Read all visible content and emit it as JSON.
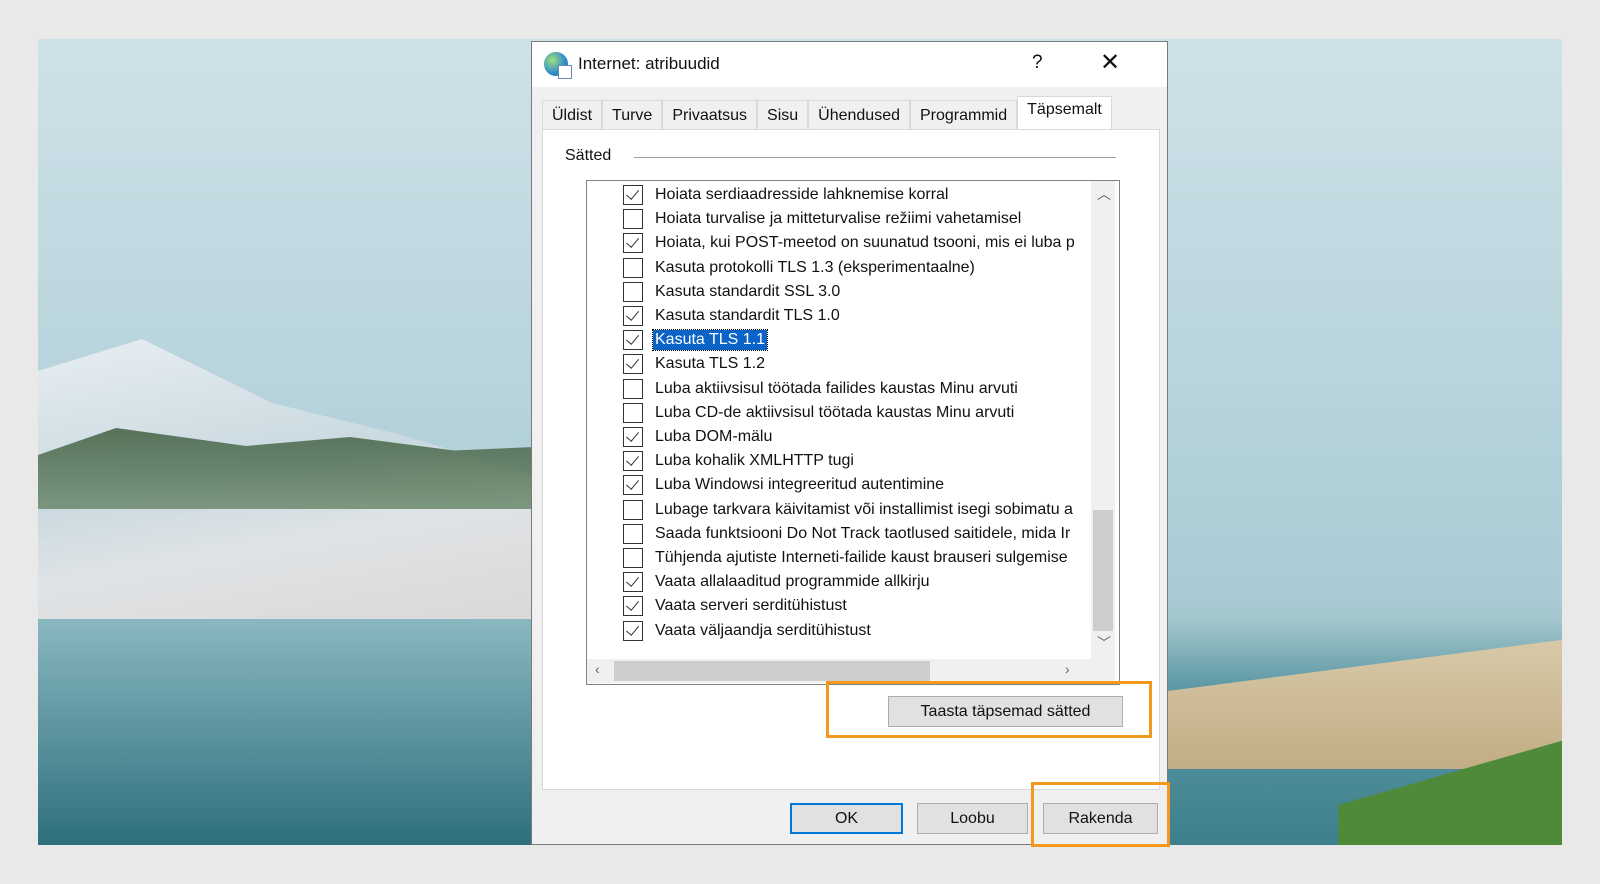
{
  "dialog": {
    "title": "Internet: atribuudid",
    "help_label": "?",
    "close_label": "✕"
  },
  "tabs": [
    {
      "label": "Üldist"
    },
    {
      "label": "Turve"
    },
    {
      "label": "Privaatsus"
    },
    {
      "label": "Sisu"
    },
    {
      "label": "Ühendused"
    },
    {
      "label": "Programmid"
    },
    {
      "label": "Täpsemalt",
      "active": true
    }
  ],
  "settings": {
    "group_label": "Sätted",
    "items": [
      {
        "label": "Hoiata serdiaadresside lahknemise korral",
        "checked": true
      },
      {
        "label": "Hoiata turvalise ja mitteturvalise režiimi vahetamisel",
        "checked": false
      },
      {
        "label": "Hoiata, kui POST-meetod on suunatud tsooni, mis ei luba p",
        "checked": true
      },
      {
        "label": "Kasuta protokolli TLS 1.3 (eksperimentaalne)",
        "checked": false
      },
      {
        "label": "Kasuta standardit SSL 3.0",
        "checked": false
      },
      {
        "label": "Kasuta standardit TLS 1.0",
        "checked": true
      },
      {
        "label": "Kasuta TLS 1.1",
        "checked": true,
        "selected": true
      },
      {
        "label": "Kasuta TLS 1.2",
        "checked": true
      },
      {
        "label": "Luba aktiivsisul töötada failides kaustas Minu arvuti",
        "checked": false
      },
      {
        "label": "Luba CD-de aktiivsisul töötada kaustas Minu arvuti",
        "checked": false
      },
      {
        "label": "Luba DOM-mälu",
        "checked": true
      },
      {
        "label": "Luba kohalik XMLHTTP tugi",
        "checked": true
      },
      {
        "label": "Luba Windowsi integreeritud autentimine",
        "checked": true
      },
      {
        "label": "Lubage tarkvara käivitamist või installimist isegi sobimatu a",
        "checked": false
      },
      {
        "label": "Saada funktsiooni Do Not Track taotlused saitidele, mida Ir",
        "checked": false
      },
      {
        "label": "Tühjenda ajutiste Interneti-failide kaust brauseri sulgemise",
        "checked": false
      },
      {
        "label": "Vaata allalaaditud programmide allkirju",
        "checked": true
      },
      {
        "label": "Vaata serveri serditühistust",
        "checked": true
      },
      {
        "label": "Vaata väljaandja serditühistust",
        "checked": true
      }
    ]
  },
  "reset_button": "Taasta täpsemad sätted",
  "footer": {
    "ok": "OK",
    "cancel": "Loobu",
    "apply": "Rakenda"
  },
  "colors": {
    "highlight": "#f39a1e",
    "selection": "#0a64c8"
  }
}
